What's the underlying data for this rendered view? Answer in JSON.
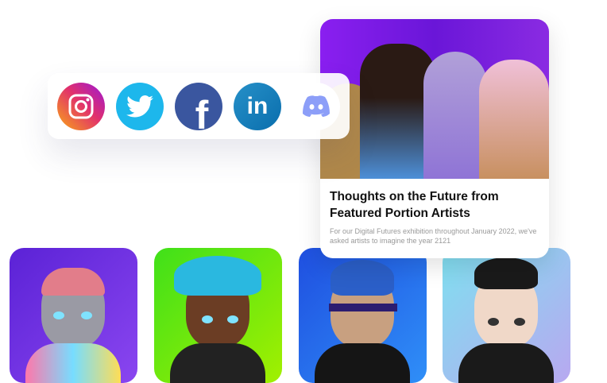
{
  "social": {
    "icons": [
      "instagram-icon",
      "twitter-icon",
      "facebook-icon",
      "linkedin-icon",
      "discord-icon"
    ],
    "facebook_glyph": "f",
    "linkedin_glyph": "in"
  },
  "article": {
    "title": "Thoughts on the Future from Featured Portion Artists",
    "description": "For our Digital Futures exhibition throughout January 2022, we've asked artists to imagine the year 2121"
  },
  "avatars": [
    {
      "background": "#6a2be0"
    },
    {
      "background": "#4be01a"
    },
    {
      "background": "#1f5ff0"
    },
    {
      "background": "#8fd8f0"
    }
  ]
}
